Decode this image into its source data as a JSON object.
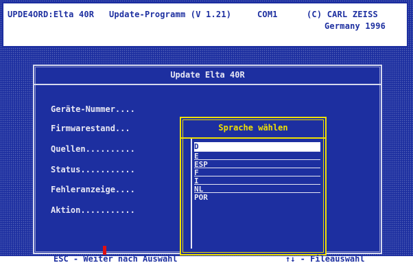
{
  "header": {
    "program": "UPDE4ORD:Elta 40R",
    "title": "Update-Programm (V 1.21)",
    "port": "COM1",
    "copyright": "(C) CARL ZEISS",
    "copyright2": "Germany 1996"
  },
  "dialog": {
    "title": "Update Elta 40R",
    "fields": [
      "Geräte-Nummer....",
      "Firmwarestand...",
      "Quellen..........",
      "Status...........",
      "Fehleranzeige....",
      "Aktion..........."
    ]
  },
  "language_picker": {
    "title": "Sprache wählen",
    "items": [
      "D",
      "E",
      "ESP",
      "F",
      "I",
      "NL",
      "POR"
    ],
    "selected": "D"
  },
  "status_bar": {
    "left": "ESC - Weiter nach Auswahl",
    "right": "↑↓ - Fileauswahl"
  },
  "colors": {
    "background": "#1d2fa0",
    "text": "#e8e8f4",
    "highlight": "#f0e000",
    "cursor": "#e01010"
  }
}
